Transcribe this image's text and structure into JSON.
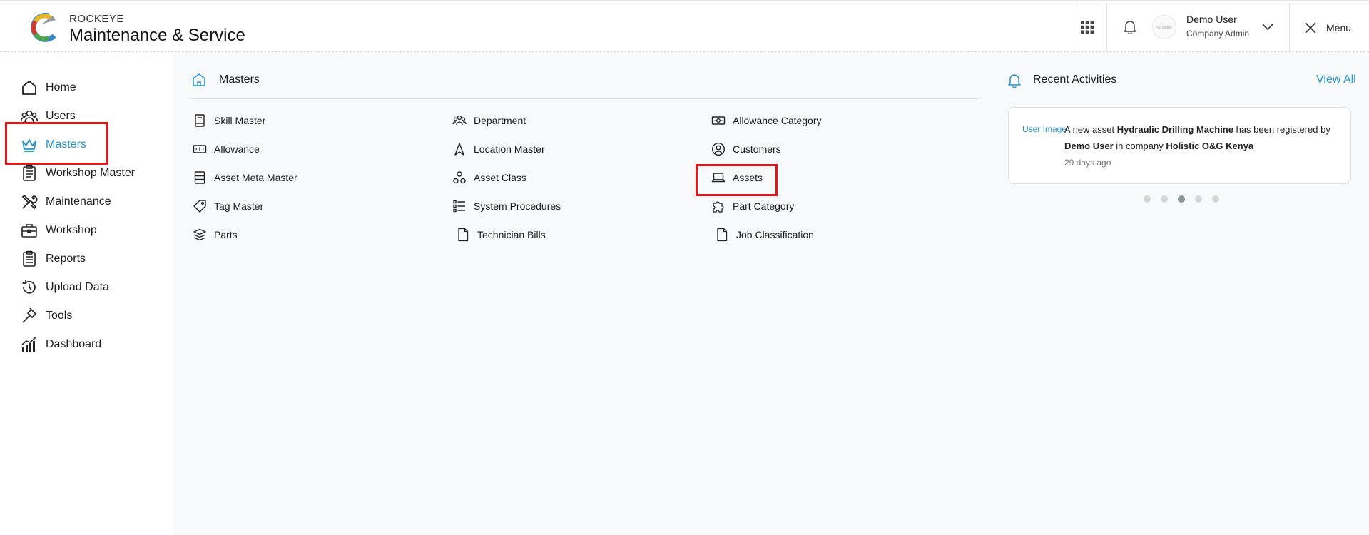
{
  "header": {
    "brand_top": "ROCKEYE",
    "brand_main": "Maintenance & Service",
    "avatar_text": "No image",
    "user_name": "Demo User",
    "user_role": "Company Admin",
    "menu_label": "Menu"
  },
  "sidebar": {
    "items": [
      {
        "label": "Home",
        "icon": "home-icon"
      },
      {
        "label": "Users",
        "icon": "users-icon"
      },
      {
        "label": "Masters",
        "icon": "crown-icon",
        "active": true
      },
      {
        "label": "Workshop Master",
        "icon": "clipboard-icon"
      },
      {
        "label": "Maintenance",
        "icon": "tools-icon"
      },
      {
        "label": "Workshop",
        "icon": "briefcase-icon"
      },
      {
        "label": "Reports",
        "icon": "report-icon"
      },
      {
        "label": "Upload Data",
        "icon": "history-icon"
      },
      {
        "label": "Tools",
        "icon": "hammer-icon"
      },
      {
        "label": "Dashboard",
        "icon": "chart-icon"
      }
    ]
  },
  "main": {
    "title": "Masters",
    "columns": [
      [
        "Skill Master",
        "Allowance",
        "Asset Meta Master",
        "Tag Master",
        "Parts"
      ],
      [
        "Department",
        "Location Master",
        "Asset Class",
        "System Procedures",
        "Technician Bills"
      ],
      [
        "Allowance Category",
        "Customers",
        "Assets",
        "Part Category",
        "Job Classification"
      ]
    ]
  },
  "activities": {
    "title": "Recent Activities",
    "view_all": "View All",
    "img_alt": "User Image",
    "text_1": "A new asset ",
    "asset": "Hydraulic Drilling Machine",
    "text_2": " has been registered by ",
    "user": "Demo User",
    "text_3": " in company ",
    "company": "Holistic O&G Kenya",
    "time": "29 days ago",
    "dots_total": 5,
    "dot_active": 3
  },
  "colors": {
    "accent": "#2a93c9",
    "highlight": "#e8141b"
  }
}
